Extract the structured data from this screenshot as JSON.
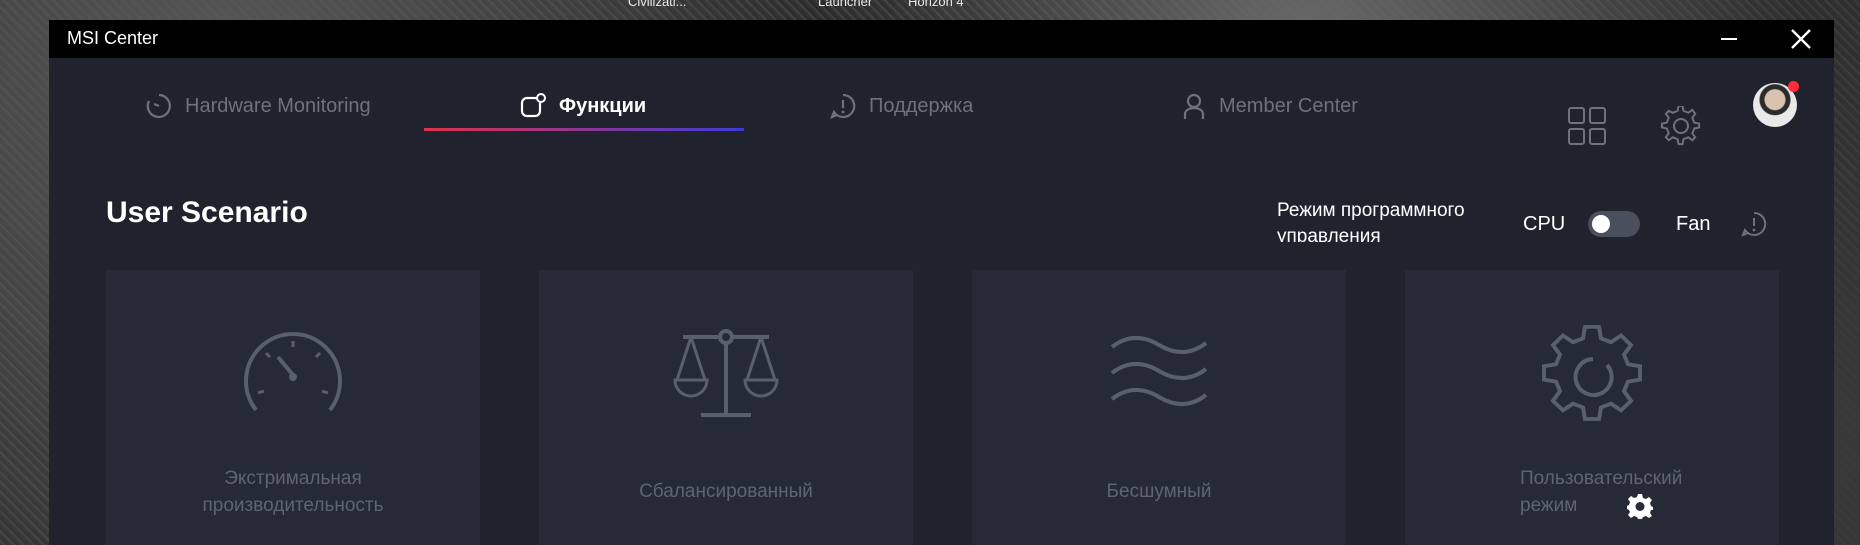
{
  "desktop": {
    "labels": [
      "Civilizati...",
      "Launcher",
      "Horizon 4"
    ]
  },
  "window": {
    "title": "MSI Center"
  },
  "nav": {
    "tabs": [
      {
        "label": "Hardware Monitoring",
        "icon": "gauge-icon",
        "active": false
      },
      {
        "label": "Функции",
        "icon": "features-icon",
        "active": true
      },
      {
        "label": "Поддержка",
        "icon": "support-icon",
        "active": false
      },
      {
        "label": "Member Center",
        "icon": "user-icon",
        "active": false
      }
    ],
    "icons": [
      "grid-icon",
      "settings-icon",
      "avatar"
    ]
  },
  "main": {
    "title": "User Scenario",
    "mode_label": "Режим программного управления",
    "cpu_label": "CPU",
    "fan_label": "Fan",
    "toggle_on": false,
    "cards": [
      {
        "icon": "speedometer-icon",
        "label_line1": "Экстримальная",
        "label_line2": "производительность"
      },
      {
        "icon": "balance-scale-icon",
        "label_line1": "Сбалансированный",
        "label_line2": ""
      },
      {
        "icon": "waves-icon",
        "label_line1": "Бесшумный",
        "label_line2": ""
      },
      {
        "icon": "gear-icon",
        "label_line1": "Пользовательский",
        "label_line2": "режим"
      }
    ]
  },
  "colors": {
    "window_bg": "#20232d",
    "card_bg": "#262a36",
    "accent_gradient_start": "#e0324b",
    "accent_gradient_end": "#3b3bd8",
    "notification": "#ff2d3c"
  }
}
